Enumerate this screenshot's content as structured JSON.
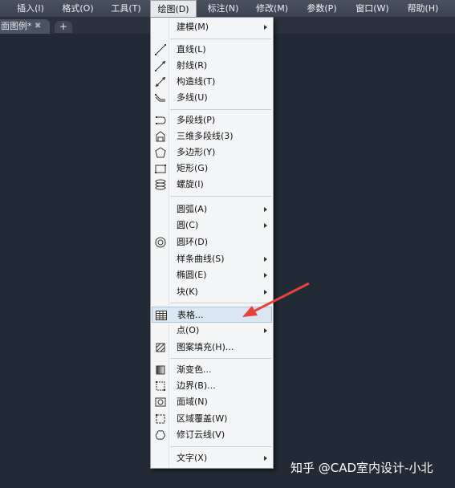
{
  "menubar": {
    "items": [
      {
        "label": "插入(I)"
      },
      {
        "label": "格式(O)"
      },
      {
        "label": "工具(T)"
      },
      {
        "label": "绘图(D)"
      },
      {
        "label": "标注(N)"
      },
      {
        "label": "修改(M)"
      },
      {
        "label": "参数(P)"
      },
      {
        "label": "窗口(W)"
      },
      {
        "label": "帮助(H)"
      }
    ]
  },
  "tabs": {
    "doc_label": "面图例*",
    "close_glyph": "✖",
    "new_glyph": "+"
  },
  "draw_menu": {
    "items": [
      {
        "label": "建模(M)",
        "submenu": true
      },
      {
        "label": "直线(L)",
        "icon": "line-icon"
      },
      {
        "label": "射线(R)",
        "icon": "ray-icon"
      },
      {
        "label": "构造线(T)",
        "icon": "construction-line-icon"
      },
      {
        "label": "多线(U)",
        "icon": "multiline-icon"
      },
      {
        "label": "多段线(P)",
        "icon": "polyline-icon"
      },
      {
        "label": "三维多段线(3)",
        "icon": "3d-polyline-icon"
      },
      {
        "label": "多边形(Y)",
        "icon": "polygon-icon"
      },
      {
        "label": "矩形(G)",
        "icon": "rectangle-icon"
      },
      {
        "label": "螺旋(I)",
        "icon": "helix-icon"
      },
      {
        "label": "圆弧(A)",
        "submenu": true
      },
      {
        "label": "圆(C)",
        "submenu": true
      },
      {
        "label": "圆环(D)",
        "icon": "donut-icon"
      },
      {
        "label": "样条曲线(S)",
        "submenu": true
      },
      {
        "label": "椭圆(E)",
        "submenu": true
      },
      {
        "label": "块(K)",
        "submenu": true
      },
      {
        "label": "表格...",
        "icon": "table-icon",
        "highlighted": true
      },
      {
        "label": "点(O)",
        "submenu": true
      },
      {
        "label": "图案填充(H)...",
        "icon": "hatch-icon"
      },
      {
        "label": "渐变色...",
        "icon": "gradient-icon"
      },
      {
        "label": "边界(B)...",
        "icon": "boundary-icon"
      },
      {
        "label": "面域(N)",
        "icon": "region-icon"
      },
      {
        "label": "区域覆盖(W)",
        "icon": "wipeout-icon"
      },
      {
        "label": "修订云线(V)",
        "icon": "revcloud-icon"
      },
      {
        "label": "文字(X)",
        "submenu": true
      }
    ]
  },
  "watermark": "知乎 @CAD室内设计-小北",
  "colors": {
    "canvas": "#222a35",
    "menu_bg": "#f4f5f7",
    "highlight": "#dbe6f3",
    "pointer_arrow": "#e8403a"
  }
}
